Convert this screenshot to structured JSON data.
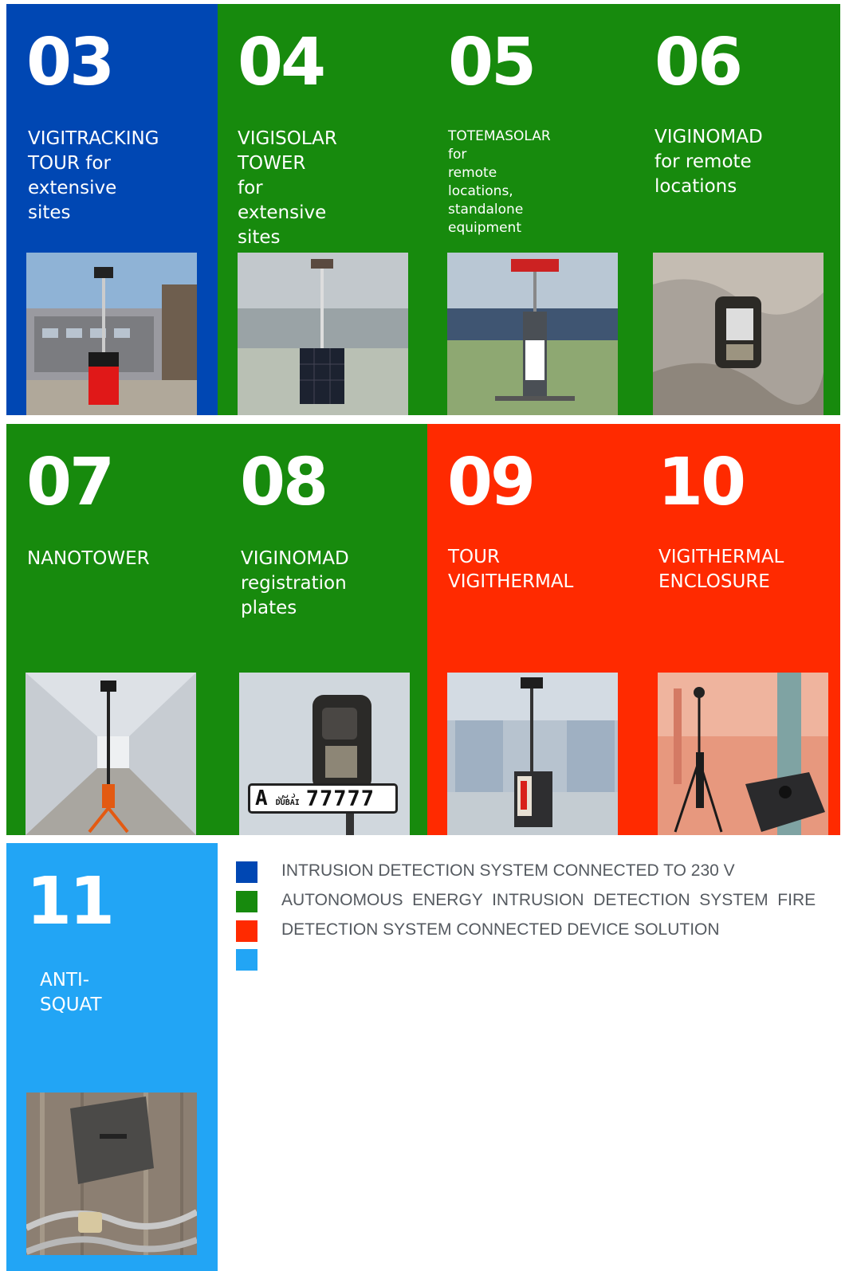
{
  "colors": {
    "blue": "#0047b3",
    "green": "#178a0d",
    "red": "#ff2a00",
    "light_blue": "#22a5f5"
  },
  "tiles": [
    {
      "number": "03",
      "title": "VIGITRACKING\nTOUR for\nextensive sites",
      "color": "blue",
      "image": "vigitracking-tower-photo"
    },
    {
      "number": "04",
      "title": "VIGISOLAR TOWER\nfor extensive sites\nlacking energy",
      "color": "green",
      "image": "vigisolar-tower-photo"
    },
    {
      "number": "05",
      "title": "TOTEMASOLAR for\nremote locations,\nstandalone equipment",
      "color": "green",
      "image": "totemasolar-photo"
    },
    {
      "number": "06",
      "title": "VIGINOMAD\nfor remote\nlocations",
      "color": "green",
      "image": "viginomad-tree-photo"
    },
    {
      "number": "07",
      "title": "NANOTOWER",
      "color": "green",
      "image": "nanotower-photo"
    },
    {
      "number": "08",
      "title": "VIGINOMAD\nregistration\nplates",
      "color": "green",
      "image": "viginomad-plates-photo",
      "plate": {
        "letter": "A",
        "arabic": "دبي",
        "city": "DUBAI",
        "digits": "77777"
      }
    },
    {
      "number": "09",
      "title": "TOUR\nVIGITHERMAL",
      "color": "red",
      "image": "tour-vigithermal-photo"
    },
    {
      "number": "10",
      "title": "VIGITHERMAL\nENCLOSURE",
      "color": "red",
      "image": "vigithermal-enclosure-photo"
    },
    {
      "number": "11",
      "title": "ANTI-SQUAT",
      "color": "light_blue",
      "image": "anti-squat-photo"
    }
  ],
  "legend": [
    {
      "color": "blue",
      "text": "INTRUSION DETECTION SYSTEM CONNECTED TO 230 V"
    },
    {
      "color": "green",
      "text": "AUTONOMOUS  ENERGY  INTRUSION  DETECTION  SYSTEM  FIRE"
    },
    {
      "color": "red",
      "text": "DETECTION SYSTEM CONNECTED DEVICE SOLUTION"
    },
    {
      "color": "light_blue",
      "text": ""
    }
  ]
}
